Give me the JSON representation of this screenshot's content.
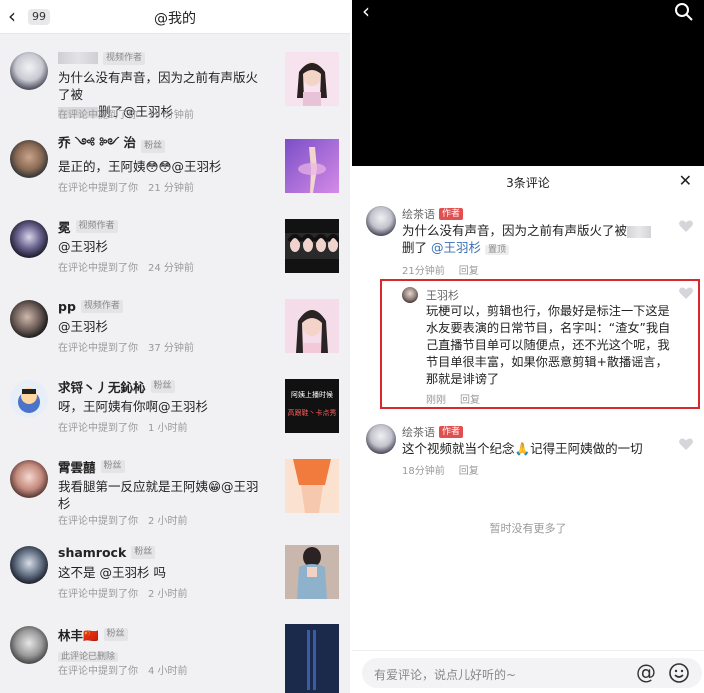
{
  "left": {
    "back_icon": "chevron-left-icon",
    "badge": "99",
    "title": "@我的",
    "mentioned_in_comment": "在评论中提到了你",
    "items": [
      {
        "name": "",
        "tag": "视频作者",
        "text": "为什么没有声音，因为之前有声版火了被",
        "text_tail": "删了@王羽杉",
        "deleted_note": "",
        "time": "19 分钟前",
        "thumb_color": "#f4d9e6"
      },
      {
        "name": "乔 ༺ ༻ 治",
        "tag": "粉丝",
        "text": "是正的，王阿姨😳😳@王羽杉",
        "time": "21 分钟前",
        "thumb_color": "#a57ad8"
      },
      {
        "name": "冕",
        "tag": "视频作者",
        "text": "@王羽杉",
        "time": "24 分钟前",
        "thumb_color": "#1a1a1a"
      },
      {
        "name": "pp",
        "tag": "视频作者",
        "text": "@王羽杉",
        "time": "37 分钟前",
        "thumb_color": "#f2d6e4"
      },
      {
        "name": "求锊丶丿无鈊杺",
        "tag": "粉丝",
        "text": "呀，王阿姨有你啊@王羽杉",
        "time": "1 小时前",
        "thumb_color": "#111111",
        "thumb_text_1": "阿姨上播时候",
        "thumb_text_2": "高跟鞋丶卡点秀"
      },
      {
        "name": "霄雲囍",
        "tag": "粉丝",
        "text": "我看腿第一反应就是王阿姨😁@王羽杉",
        "time": "2 小时前",
        "thumb_color": "#f5a36b"
      },
      {
        "name": "shamrock",
        "tag": "粉丝",
        "text": "这不是 @王羽杉 吗",
        "time": "2 小时前",
        "thumb_color": "#6f8fa6"
      },
      {
        "name": "林丰🇨🇳",
        "tag": "粉丝",
        "deleted_note": "此评论已删除",
        "time": "4 小时前",
        "thumb_color": "#1b2a4a"
      }
    ]
  },
  "right": {
    "back_icon": "chevron-left-icon",
    "search_icon": "search-icon",
    "sheet_title": "3条评论",
    "close_icon": "close-icon",
    "comments": [
      {
        "name": "绘茶语",
        "badge": "作者",
        "text_a": "为什么没有声音，因为之前有声版火了被",
        "text_b": "删了",
        "mention": "@王羽杉",
        "pin": "置顶",
        "time": "21分钟前",
        "reply": "回复"
      },
      {
        "name": "王羽杉",
        "text": "玩梗可以，剪辑也行，你最好是标注一下这是水友要表演的日常节目，名字叫：“渣女”我自己直播节目单可以随便点，还不光这个呢，我节目单很丰富，如果你恶意剪辑+散播谣言，那就是诽谤了",
        "time": "刚刚",
        "reply": "回复"
      },
      {
        "name": "绘茶语",
        "badge": "作者",
        "text": "这个视频就当个纪念🙏记得王阿姨做的一切",
        "time": "18分钟前",
        "reply": "回复"
      }
    ],
    "no_more": "暂时没有更多了",
    "input_placeholder": "有爱评论，说点儿好听的~",
    "at_icon": "at-icon",
    "emoji_icon": "emoji-icon"
  },
  "colors": {
    "highlight_border": "#d8282c",
    "mention_blue": "#3a6fb3",
    "author_badge": "#e05050"
  }
}
